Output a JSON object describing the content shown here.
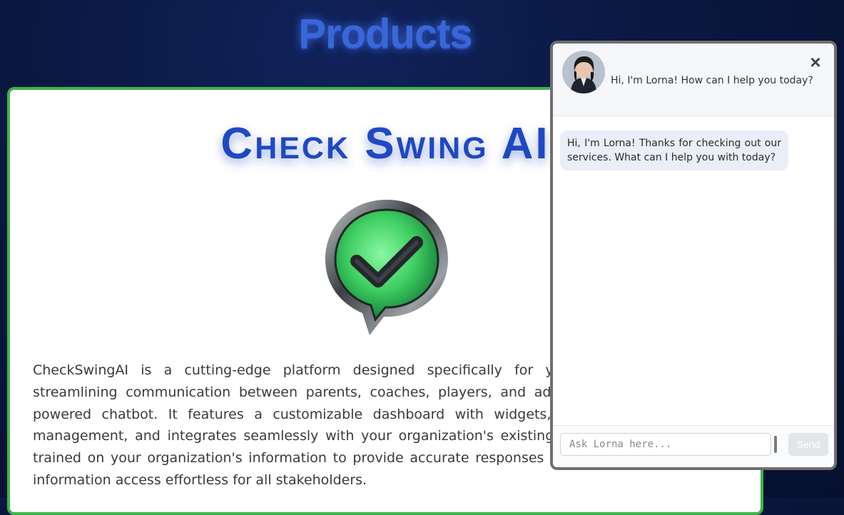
{
  "page": {
    "title": "Products"
  },
  "product": {
    "name": "Check Swing AI",
    "logo_icon": "checkmark-chat-bubble-icon",
    "description": "CheckSwingAI is a cutting-edge platform designed specifically for youth sports organizations, streamlining communication between parents, coaches, players, and administrators through an AI-powered chatbot. It features a customizable dashboard with widgets, calendars, and document management, and integrates seamlessly with your organization's existing website. Our AI chatbot is trained on your organization's information to provide accurate responses to common queries, making information access effortless for all stakeholders."
  },
  "chat": {
    "greeting": "Hi, I'm Lorna! How can I help you today?",
    "close_icon": "close-icon",
    "messages": [
      {
        "from": "bot",
        "text": "Hi, I'm Lorna! Thanks for checking out our services. What can I help you with today?"
      }
    ],
    "input_placeholder": "Ask Lorna here...",
    "send_label": "Send"
  },
  "colors": {
    "background": "#0a1840",
    "card_border": "#3db54a",
    "title_blue": "#3a67d8",
    "product_name_blue": "#1f48c2",
    "bubble": "#e9eef8"
  }
}
